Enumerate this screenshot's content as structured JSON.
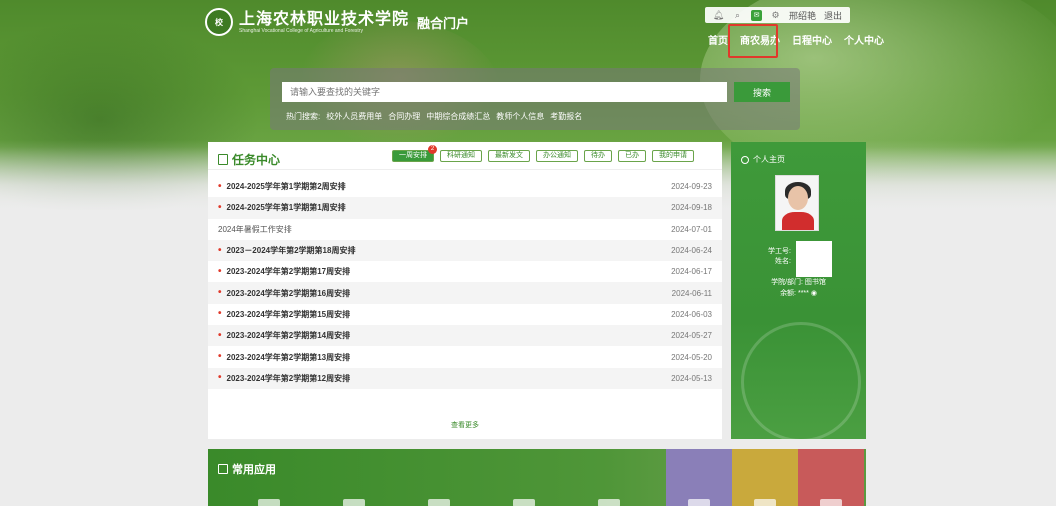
{
  "header": {
    "logo_text": "上海农林职业技术学院",
    "logo_en": "Shanghai Vocational College of Agriculture and Forestry",
    "portal_title": "融合门户",
    "topbar": {
      "user_name": "邢绍艳",
      "logout_label": "退出"
    },
    "nav": [
      "首页",
      "商农易办",
      "日程中心",
      "个人中心"
    ]
  },
  "search": {
    "placeholder": "请输入要查找的关键字",
    "button_label": "搜索",
    "hot_label": "热门搜索:",
    "hot_words": [
      "校外人员费用单",
      "合同办理",
      "中期综合成绩汇总",
      "教师个人信息",
      "考勤报名"
    ]
  },
  "task_center": {
    "title": "任务中心",
    "tabs": [
      "一周安排",
      "科研通知",
      "最新发文",
      "办公通知",
      "待办",
      "已办",
      "我的申请"
    ],
    "badge": "2",
    "rows": [
      {
        "title": "2024-2025学年第1学期第2周安排",
        "date": "2024-09-23"
      },
      {
        "title": "2024-2025学年第1学期第1周安排",
        "date": "2024-09-18"
      },
      {
        "title": "2024年暑假工作安排",
        "date": "2024-07-01"
      },
      {
        "title": "2023－2024学年第2学期第18周安排",
        "date": "2024-06-24"
      },
      {
        "title": "2023-2024学年第2学期第17周安排",
        "date": "2024-06-17"
      },
      {
        "title": "2023-2024学年第2学期第16周安排",
        "date": "2024-06-11"
      },
      {
        "title": "2023-2024学年第2学期第15周安排",
        "date": "2024-06-03"
      },
      {
        "title": "2023-2024学年第2学期第14周安排",
        "date": "2024-05-27"
      },
      {
        "title": "2023-2024学年第2学期第13周安排",
        "date": "2024-05-20"
      },
      {
        "title": "2023-2024学年第2学期第12周安排",
        "date": "2024-05-13"
      }
    ],
    "more_label": "查看更多"
  },
  "profile": {
    "title": "个人主页",
    "id_label": "学工号:",
    "name_label": "姓名:",
    "dept_label": "学院/部门:",
    "dept_value": "图书馆",
    "balance_label": "余额:",
    "balance_value": "****"
  },
  "apps": {
    "title": "常用应用"
  },
  "colors": {
    "brand_green": "#3a9a3a",
    "highlight_red": "#e0392b"
  }
}
